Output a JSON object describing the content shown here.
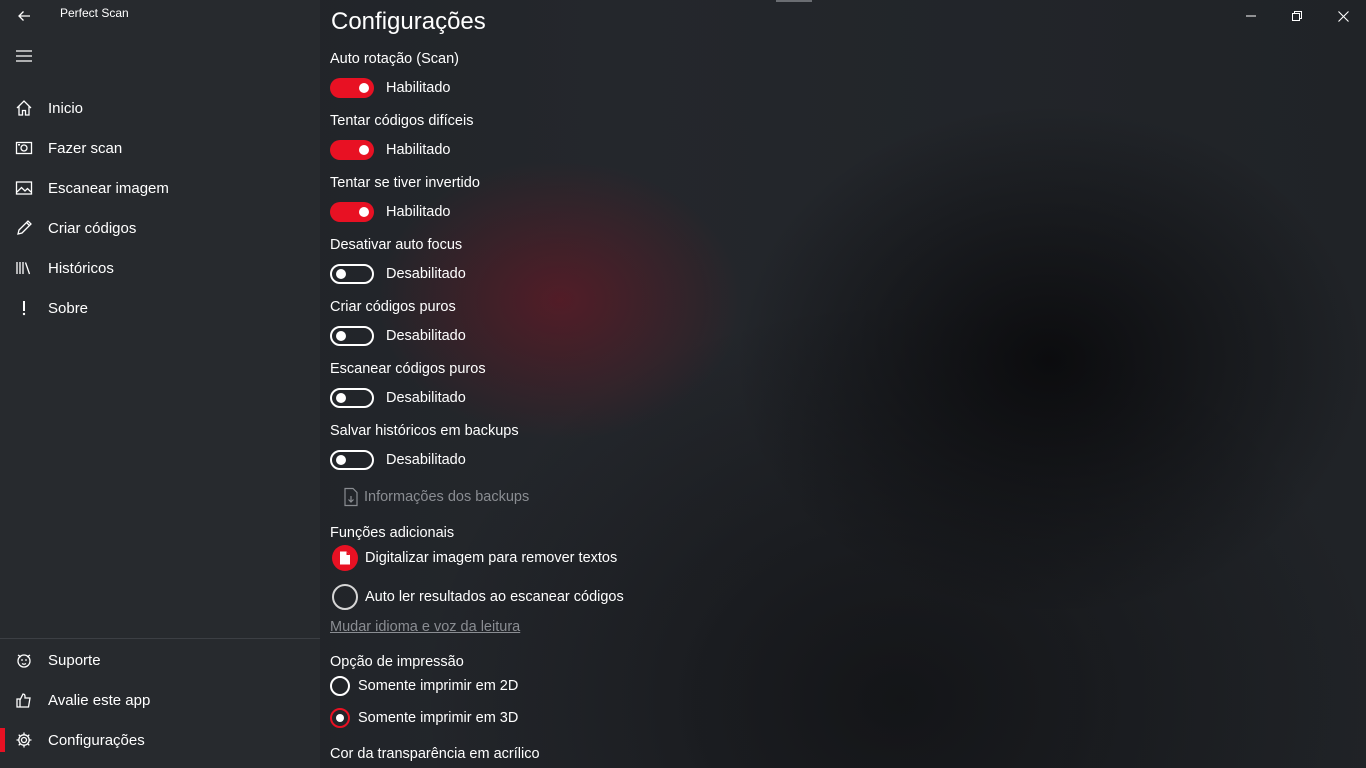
{
  "app": {
    "title": "Perfect Scan"
  },
  "nav": {
    "items": [
      {
        "label": "Inicio",
        "icon": "home-icon"
      },
      {
        "label": "Fazer scan",
        "icon": "camera-icon"
      },
      {
        "label": "Escanear imagem",
        "icon": "image-icon"
      },
      {
        "label": "Criar códigos",
        "icon": "pencil-icon"
      },
      {
        "label": "Históricos",
        "icon": "library-icon"
      },
      {
        "label": "Sobre",
        "icon": "exclamation-icon"
      }
    ],
    "footer": [
      {
        "label": "Suporte",
        "icon": "support-icon"
      },
      {
        "label": "Avalie este app",
        "icon": "like-icon"
      },
      {
        "label": "Configurações",
        "icon": "gear-icon",
        "active": true
      }
    ]
  },
  "page": {
    "title": "Configurações"
  },
  "settings": [
    {
      "label": "Auto rotação (Scan)",
      "state": "Habilitado",
      "on": true
    },
    {
      "label": "Tentar códigos difíceis",
      "state": "Habilitado",
      "on": true
    },
    {
      "label": "Tentar se tiver invertido",
      "state": "Habilitado",
      "on": true
    },
    {
      "label": "Desativar auto focus",
      "state": "Desabilitado",
      "on": false
    },
    {
      "label": "Criar códigos puros",
      "state": "Desabilitado",
      "on": false
    },
    {
      "label": "Escanear códigos puros",
      "state": "Desabilitado",
      "on": false
    },
    {
      "label": "Salvar históricos em backups",
      "state": "Desabilitado",
      "on": false
    }
  ],
  "backup_info": {
    "label": "Informações dos backups"
  },
  "extra": {
    "title": "Funções adicionais",
    "options": [
      {
        "label": "Digitalizar imagem para remover textos",
        "checked": true
      },
      {
        "label": "Auto ler resultados ao escanear códigos",
        "checked": false
      }
    ],
    "link": "Mudar idioma e voz da leitura"
  },
  "print": {
    "title": "Opção de impressão",
    "options": [
      {
        "label": "Somente imprimir em 2D",
        "selected": false
      },
      {
        "label": "Somente imprimir em 3D",
        "selected": true
      }
    ]
  },
  "acrylic": {
    "title": "Cor da transparência em acrílico"
  },
  "colors": {
    "accent": "#e81123",
    "sidebar": "#272a2e"
  }
}
